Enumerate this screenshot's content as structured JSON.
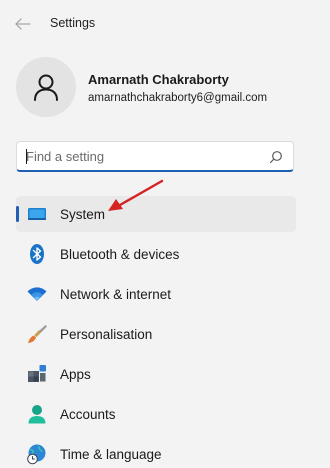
{
  "window": {
    "title": "Settings"
  },
  "user": {
    "name": "Amarnath Chakraborty",
    "email": "amarnathchakraborty6@gmail.com"
  },
  "search": {
    "placeholder": "Find a setting",
    "value": ""
  },
  "nav": {
    "selected": "System",
    "items": [
      {
        "label": "System",
        "icon": "system-icon",
        "selected": true
      },
      {
        "label": "Bluetooth & devices",
        "icon": "bluetooth-icon",
        "selected": false
      },
      {
        "label": "Network & internet",
        "icon": "wifi-icon",
        "selected": false
      },
      {
        "label": "Personalisation",
        "icon": "brush-icon",
        "selected": false
      },
      {
        "label": "Apps",
        "icon": "apps-icon",
        "selected": false
      },
      {
        "label": "Accounts",
        "icon": "accounts-icon",
        "selected": false
      },
      {
        "label": "Time & language",
        "icon": "time-language-icon",
        "selected": false
      }
    ]
  },
  "colors": {
    "accent": "#1f5fb5",
    "annotation_arrow": "#d42323",
    "background": "#f3f3f3",
    "selected_row": "#e9e9e9"
  }
}
